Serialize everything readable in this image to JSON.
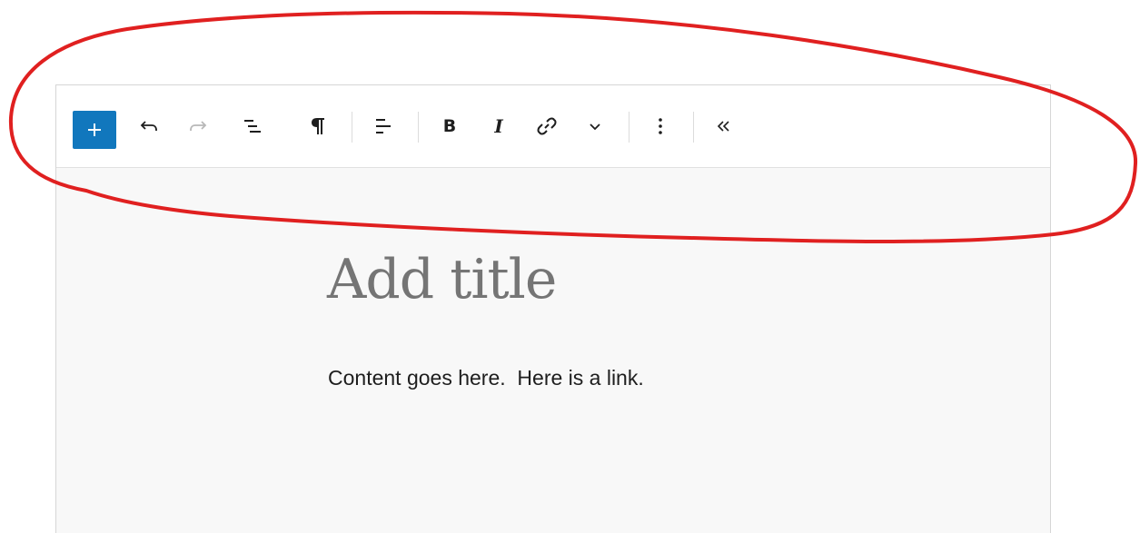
{
  "toolbar": {
    "buttons": [
      {
        "name": "add-block-button",
        "icon": "plus-icon",
        "color": "#1177bd"
      },
      {
        "name": "undo-button",
        "icon": "undo-icon"
      },
      {
        "name": "redo-button",
        "icon": "redo-icon",
        "state": "disabled"
      },
      {
        "name": "document-overview-button",
        "icon": "list-view-icon"
      },
      {
        "name": "paragraph-block-button",
        "icon": "pilcrow-icon"
      },
      {
        "name": "align-button",
        "icon": "align-left-icon"
      },
      {
        "name": "bold-button",
        "label": "B"
      },
      {
        "name": "italic-button",
        "label": "I"
      },
      {
        "name": "link-button",
        "icon": "link-icon"
      },
      {
        "name": "more-formatting-button",
        "icon": "chevron-down-icon"
      },
      {
        "name": "options-button",
        "icon": "vertical-ellipsis-icon"
      },
      {
        "name": "collapse-toolbar-button",
        "icon": "double-chevron-left-icon"
      }
    ]
  },
  "editor": {
    "title_placeholder": "Add title",
    "content_text": "Content goes here.  Here is a link."
  },
  "annotation": {
    "shape": "hand-drawn ellipse around toolbar",
    "color": "#e02020"
  }
}
